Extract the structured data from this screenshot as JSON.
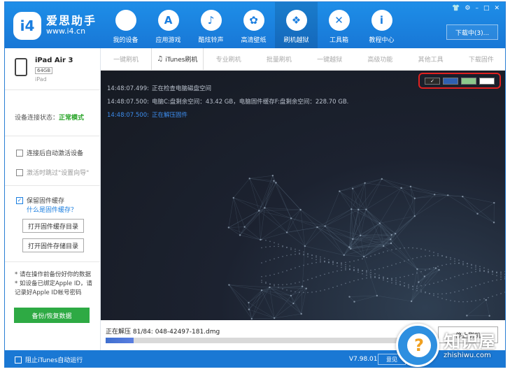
{
  "app": {
    "logo_mark": "i4",
    "title": "爱思助手",
    "url": "www.i4.cn"
  },
  "nav": [
    {
      "label": "我的设备",
      "icon": "apple-icon",
      "glyph": ""
    },
    {
      "label": "应用游戏",
      "icon": "app-store-icon",
      "glyph": "A"
    },
    {
      "label": "酷炫铃声",
      "icon": "bell-icon",
      "glyph": "♪"
    },
    {
      "label": "高清壁纸",
      "icon": "flower-icon",
      "glyph": "✿"
    },
    {
      "label": "刷机越狱",
      "icon": "dropbox-icon",
      "glyph": "❖"
    },
    {
      "label": "工具箱",
      "icon": "tools-icon",
      "glyph": "✕"
    },
    {
      "label": "教程中心",
      "icon": "info-icon",
      "glyph": "i"
    }
  ],
  "window_controls": {
    "shirt": "👕",
    "settings": "⚙",
    "minimize": "–",
    "maximize": "□",
    "close": "✕"
  },
  "download_label": "下载中(3)...",
  "device": {
    "name": "iPad Air 3",
    "capacity": "64GB",
    "model": "iPad"
  },
  "connection": {
    "label": "设备连接状态：",
    "value": "正常模式"
  },
  "options": {
    "auto_activate": "连接后自动激活设备",
    "skip_setup": "激活时跳过\"设置向导\"",
    "keep_firmware": "保留固件缓存",
    "what_is_cache": "什么是固件缓存？"
  },
  "buttons": {
    "open_cache_dir": "打开固件缓存目录",
    "open_storage_dir": "打开固件存储目录",
    "backup_restore": "备份/恢复数据",
    "stop_flash": "停止刷机",
    "feedback": "意见"
  },
  "notes": [
    "* 请在操作前备份好你的数据",
    "* 如设备已绑定Apple ID，请记录好Apple ID帐号密码"
  ],
  "tabs": [
    {
      "label": "一键刷机",
      "active": false
    },
    {
      "label": "iTunes刷机",
      "active": true
    },
    {
      "label": "专业刷机",
      "active": false
    },
    {
      "label": "批量刷机",
      "active": false
    },
    {
      "label": "一键越狱",
      "active": false
    },
    {
      "label": "高级功能",
      "active": false
    },
    {
      "label": "其他工具",
      "active": false
    },
    {
      "label": "下载固件",
      "active": false
    }
  ],
  "log": [
    {
      "time": "14:48:07.499:",
      "text": "正在检查电脑磁盘空间"
    },
    {
      "time": "14:48:07.500:",
      "text": "电脑C:盘剩余空间：43.42 GB，电脑固件缓存F:盘剩余空间：228.70 GB."
    },
    {
      "time": "14:48:07.500:",
      "text": "正在解压固件"
    }
  ],
  "theme_swatches": [
    {
      "color": "#2a2a2a",
      "selected": true,
      "mark": "✓"
    },
    {
      "color": "#2f5fb0",
      "selected": false,
      "mark": ""
    },
    {
      "color": "#8cc88c",
      "selected": false,
      "mark": ""
    },
    {
      "color": "#ffffff",
      "selected": false,
      "mark": ""
    }
  ],
  "progress": {
    "text": "正在解压 81/84: 048-42497-181.dmg",
    "fraction": 0.085
  },
  "statusbar": {
    "itunes_autorun": "阻止iTunes自动运行",
    "version": "V7.98.01"
  },
  "watermark": {
    "brand": "知识屋",
    "domain": "zhishiwu.com",
    "mark": "?"
  },
  "colors": {
    "accent": "#1a7ee0",
    "success": "#2aa52a",
    "backup": "#2eaa44",
    "highlight_border": "#e02020"
  }
}
